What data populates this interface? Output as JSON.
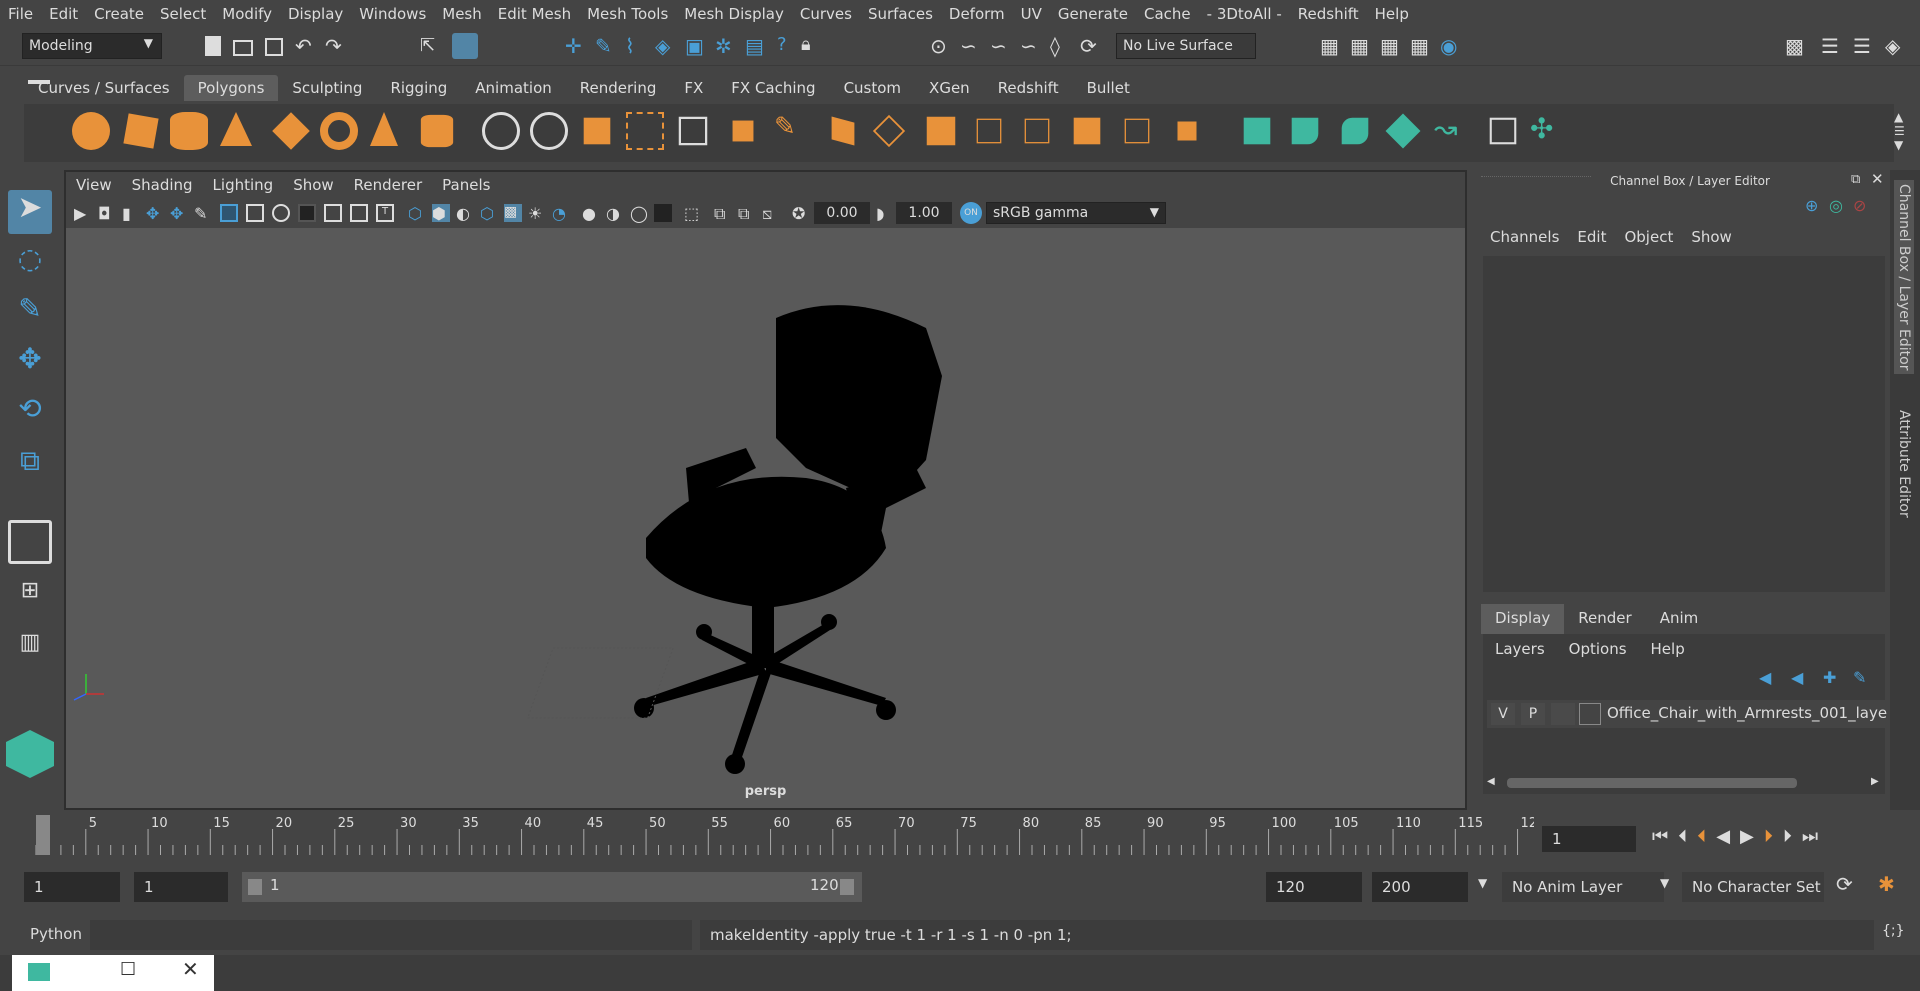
{
  "menu": [
    "File",
    "Edit",
    "Create",
    "Select",
    "Modify",
    "Display",
    "Windows",
    "Mesh",
    "Edit Mesh",
    "Mesh Tools",
    "Mesh Display",
    "Curves",
    "Surfaces",
    "Deform",
    "UV",
    "Generate",
    "Cache",
    "- 3DtoAll -",
    "Redshift",
    "Help"
  ],
  "status": {
    "mode": "Modeling",
    "live_surface": "No Live Surface"
  },
  "shelf_tabs": [
    "Curves / Surfaces",
    "Polygons",
    "Sculpting",
    "Rigging",
    "Animation",
    "Rendering",
    "FX",
    "FX Caching",
    "Custom",
    "XGen",
    "Redshift",
    "Bullet"
  ],
  "shelf_active": "Polygons",
  "viewport": {
    "menu": [
      "View",
      "Shading",
      "Lighting",
      "Show",
      "Renderer",
      "Panels"
    ],
    "exposure": "0.00",
    "gamma": "1.00",
    "colorspace": "sRGB gamma",
    "camera_label": "persp"
  },
  "channel_box": {
    "title": "Channel Box / Layer Editor",
    "menu": [
      "Channels",
      "Edit",
      "Object",
      "Show"
    ],
    "layer_tabs": [
      "Display",
      "Render",
      "Anim"
    ],
    "layer_menu": [
      "Layers",
      "Options",
      "Help"
    ],
    "layer": {
      "v": "V",
      "p": "P",
      "name": "Office_Chair_with_Armrests_001_laye"
    }
  },
  "side_tabs": [
    "Channel Box / Layer Editor",
    "Attribute Editor"
  ],
  "timeline": {
    "ticks": [
      "1",
      "5",
      "10",
      "15",
      "20",
      "25",
      "30",
      "35",
      "40",
      "45",
      "50",
      "55",
      "60",
      "65",
      "70",
      "75",
      "80",
      "85",
      "90",
      "95",
      "100",
      "105",
      "110",
      "115",
      "12"
    ],
    "current_frame": "1"
  },
  "range": {
    "start": "1",
    "current": "1",
    "slider_start": "1",
    "slider_end": "120",
    "end": "120",
    "max": "200",
    "anim_layer": "No Anim Layer",
    "char_set": "No Character Set"
  },
  "command": {
    "language": "Python",
    "result": "makeIdentity -apply true -t 1 -r 1 -s 1 -n 0 -pn 1;"
  },
  "colors": {
    "accent": "#4a9fd6",
    "shelf_orange": "#e8923a",
    "shelf_teal": "#3fb8a0",
    "active_tool": "#5285a6"
  }
}
